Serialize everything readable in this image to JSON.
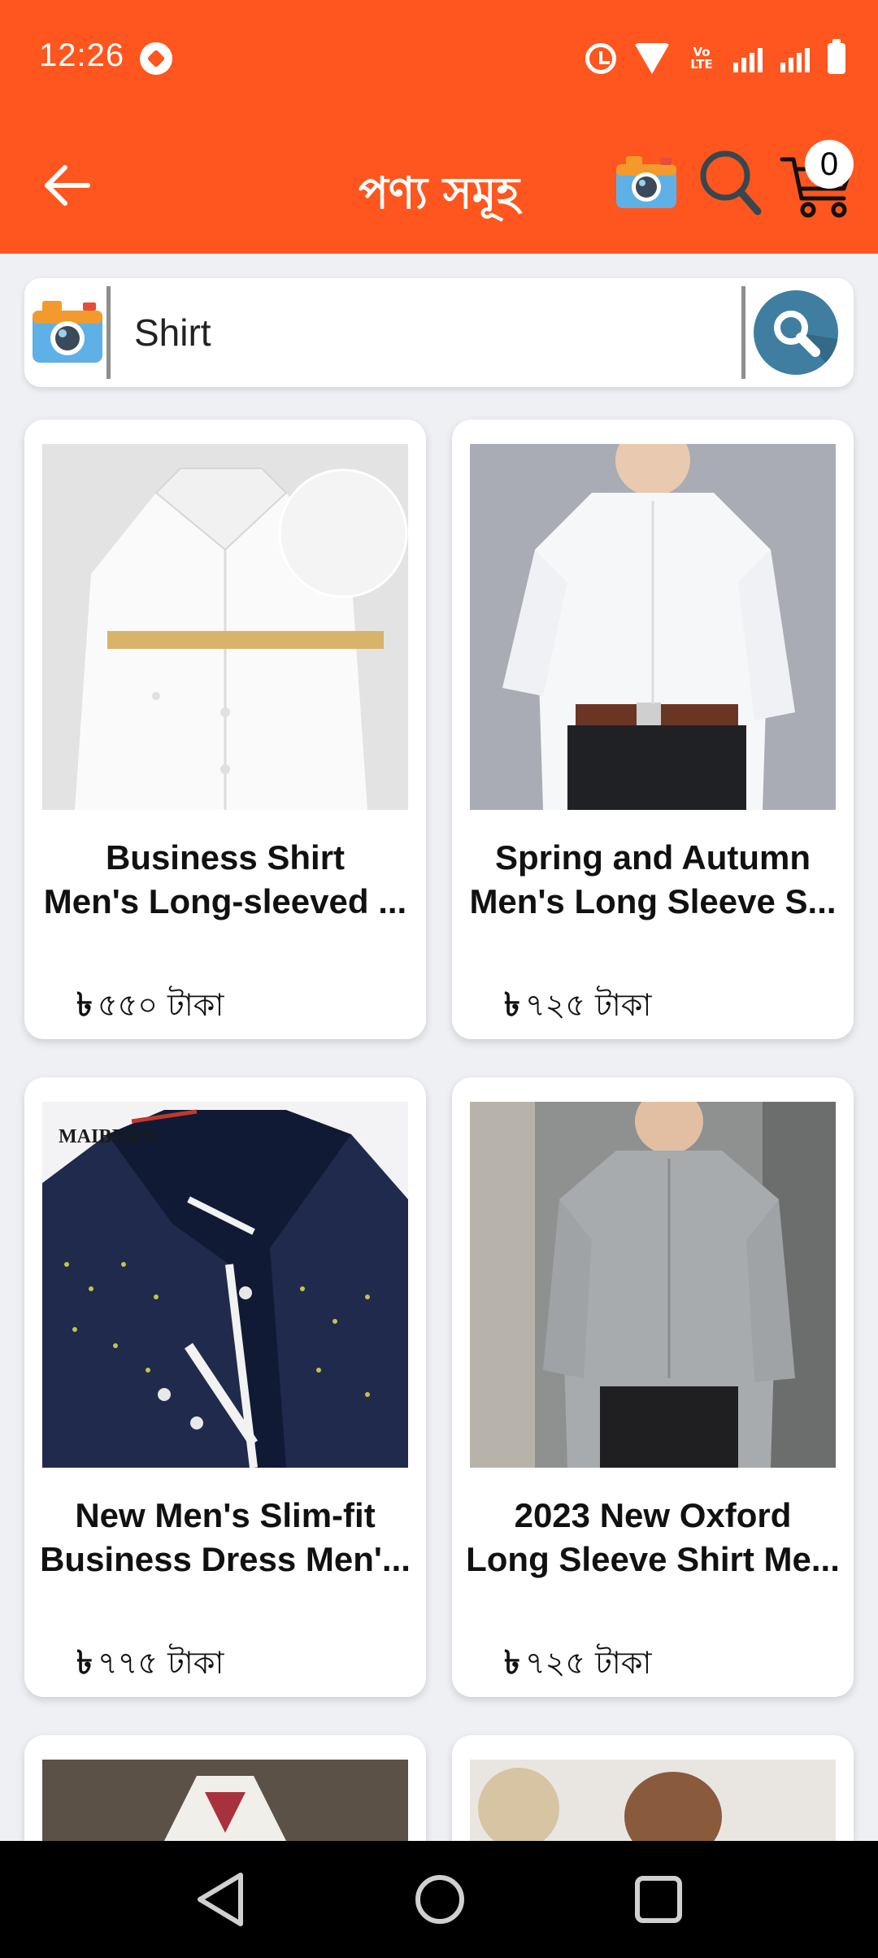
{
  "status_bar": {
    "time": "12:26",
    "volte": "VoLTE"
  },
  "app_bar": {
    "title": "পণ্য সমূহ",
    "cart_count": "0"
  },
  "search": {
    "value": "Shirt",
    "placeholder": ""
  },
  "products": [
    {
      "title_line1": "Business Shirt",
      "title_line2": "Men's Long-sleeved ...",
      "currency": "৳",
      "price": "৫৫০ টাকা"
    },
    {
      "title_line1": "Spring and Autumn",
      "title_line2": "Men's Long Sleeve S...",
      "currency": "৳",
      "price": "৭২৫ টাকা"
    },
    {
      "title_line1": "New Men's Slim-fit",
      "title_line2": "Business Dress Men'...",
      "currency": "৳",
      "price": "৭৭৫ টাকা"
    },
    {
      "title_line1": "2023 New Oxford",
      "title_line2": "Long Sleeve Shirt Me...",
      "currency": "৳",
      "price": "৭২৫ টাকা"
    }
  ],
  "brand_watermark": "MAIBISEN",
  "colors": {
    "primary": "#fe561e",
    "background": "#eef0f4",
    "search_accent": "#3f7ea0"
  }
}
